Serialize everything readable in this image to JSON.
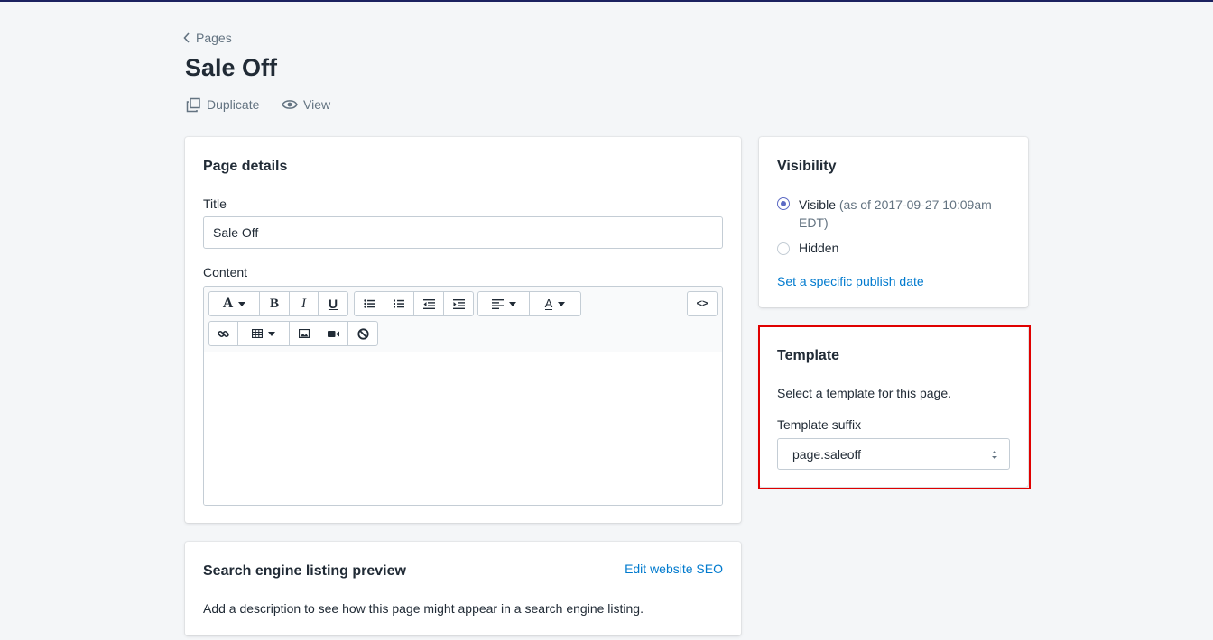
{
  "breadcrumb": {
    "label": "Pages"
  },
  "page_title": "Sale Off",
  "actions": {
    "duplicate": "Duplicate",
    "view": "View"
  },
  "page_details": {
    "heading": "Page details",
    "title_label": "Title",
    "title_value": "Sale Off",
    "content_label": "Content",
    "toolbar": {
      "font_glyph": "A",
      "bold": "B",
      "italic": "I",
      "underline": "U",
      "color_glyph": "A",
      "source_code": "<>"
    }
  },
  "seo": {
    "heading": "Search engine listing preview",
    "edit_link": "Edit website SEO",
    "description": "Add a description to see how this page might appear in a search engine listing."
  },
  "visibility": {
    "heading": "Visibility",
    "visible_label": "Visible",
    "visible_note": "(as of 2017-09-27 10:09am EDT)",
    "hidden_label": "Hidden",
    "publish_link": "Set a specific publish date"
  },
  "template": {
    "heading": "Template",
    "description": "Select a template for this page.",
    "suffix_label": "Template suffix",
    "suffix_value": "page.saleoff"
  },
  "colors": {
    "accent": "#5c6ac4",
    "link": "#007ace",
    "highlight": "#e00000",
    "topbar": "#1c2260"
  }
}
